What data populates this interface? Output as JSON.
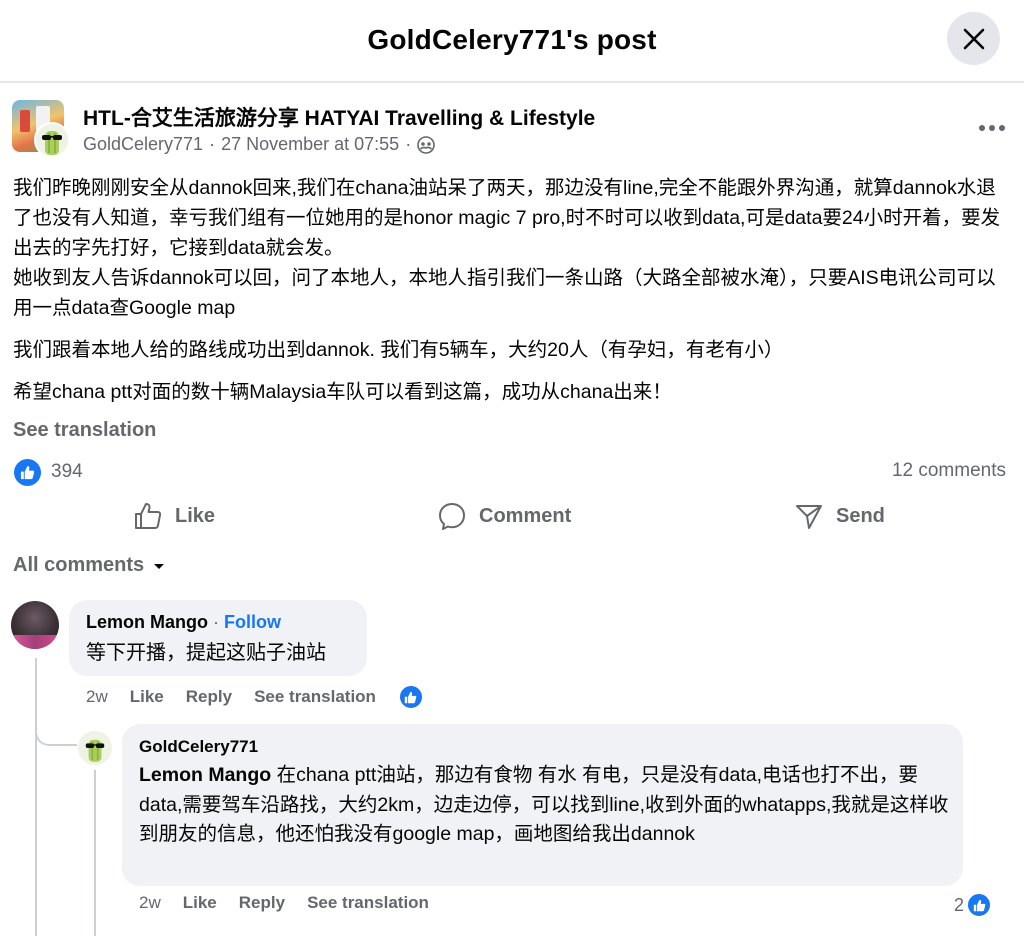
{
  "header": {
    "title": "GoldCelery771's post"
  },
  "post": {
    "group_name": "HTL-合艾生活旅游分享 HATYAI Travelling & Lifestyle",
    "author": "GoldCelery771",
    "separator": "·",
    "timestamp": "27 November at 07:55",
    "paragraphs": [
      "我们昨晚刚刚安全从dannok回来,我们在chana油站呆了两天，那边没有line,完全不能跟外界沟通，就算dannok水退了也没有人知道，幸亏我们组有一位她用的是honor magic 7 pro,时不时可以收到data,可是data要24小时开着，要发出去的字先打好，它接到data就会发。",
      "她收到友人告诉dannok可以回，问了本地人，本地人指引我们一条山路（大路全部被水淹），只要AIS电讯公司可以用一点data查Google map",
      "我们跟着本地人给的路线成功出到dannok. 我们有5辆车，大约20人（有孕妇，有老有小）",
      "希望chana ptt对面的数十辆Malaysia车队可以看到这篇，成功从chana出来！"
    ],
    "see_translation": "See translation",
    "reaction_count": "394",
    "comment_count": "12 comments",
    "actions": {
      "like": "Like",
      "comment": "Comment",
      "send": "Send"
    }
  },
  "comments_filter": "All comments",
  "comments": [
    {
      "author": "Lemon Mango",
      "follow_sep": "·",
      "follow": "Follow",
      "text": "等下开播，提起这贴子油站",
      "time": "2w",
      "like": "Like",
      "reply": "Reply",
      "see_translation": "See translation"
    },
    {
      "author": "GoldCelery771",
      "mention": "Lemon Mango",
      "text": " 在chana ptt油站，那边有食物 有水 有电，只是没有data,电话也打不出，要data,需要驾车沿路找，大约2km，边走边停，可以找到line,收到外面的whatapps,我就是这样收到朋友的信息，他还怕我没有google map，画地图给我出dannok",
      "time": "2w",
      "like": "Like",
      "reply": "Reply",
      "see_translation": "See translation",
      "likes": "2"
    }
  ],
  "colors": {
    "accent": "#1877f2",
    "muted": "#65676b",
    "bubble": "#f0f2f5"
  }
}
